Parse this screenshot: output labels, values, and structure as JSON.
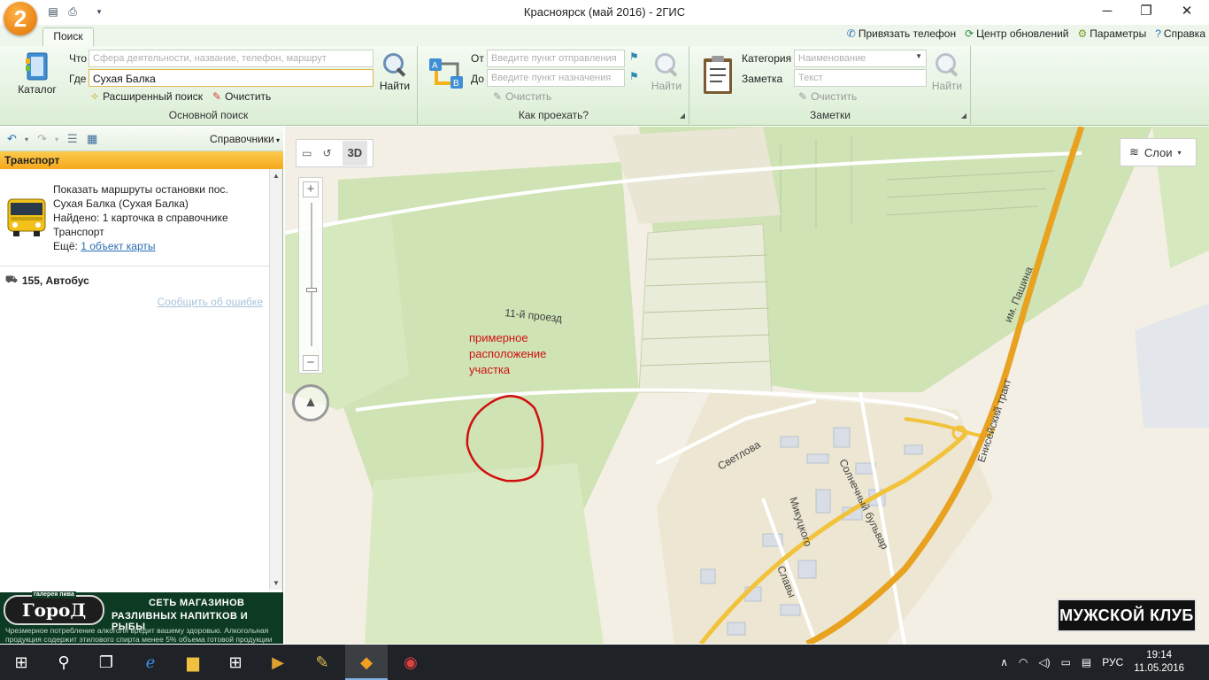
{
  "window": {
    "title": "Красноярск (май 2016) - 2ГИС",
    "logo": "2",
    "minimize": "─",
    "maximize": "❐",
    "close": "✕"
  },
  "ribbon": {
    "active_tab": "Поиск",
    "top_links": [
      {
        "icon": "phone-icon",
        "label": "Привязать телефон"
      },
      {
        "icon": "refresh-icon",
        "label": "Центр обновлений"
      },
      {
        "icon": "gear-icon",
        "label": "Параметры"
      },
      {
        "icon": "help-icon",
        "label": "Справка"
      }
    ],
    "main_search": {
      "title": "Основной поиск",
      "catalog_label": "Каталог",
      "what_label": "Что",
      "what_placeholder": "Сфера деятельности, название, телефон, маршрут",
      "where_label": "Где",
      "where_value": "Сухая Балка",
      "find_label": "Найти",
      "advanced_label": "Расширенный поиск",
      "clear_label": "Очистить"
    },
    "route": {
      "title": "Как проехать?",
      "from_label": "От",
      "from_placeholder": "Введите пункт отправления",
      "to_label": "До",
      "to_placeholder": "Введите пункт назначения",
      "find_label": "Найти",
      "clear_label": "Очистить"
    },
    "notes": {
      "title": "Заметки",
      "category_label": "Категория",
      "category_placeholder": "Наименование",
      "note_label": "Заметка",
      "note_placeholder": "Текст",
      "find_label": "Найти",
      "clear_label": "Очистить"
    }
  },
  "left_panel": {
    "directory_label": "Справочники",
    "section": "Транспорт",
    "result": {
      "line1": "Показать маршруты остановки пос.",
      "line2": "Сухая Балка (Сухая Балка)",
      "line3": "Найдено: 1 карточка в справочнике",
      "line4": "Транспорт",
      "more_label": "Ещё:",
      "more_link": "1 объект карты"
    },
    "route_item": "155, Автобус",
    "report_link": "Сообщить об ошибке",
    "ad": {
      "logo": "ГороД",
      "logo_small": "галерея пива",
      "line1": "СЕТЬ МАГАЗИНОВ",
      "line2": "РАЗЛИВНЫХ НАПИТКОВ И РЫБЫ",
      "warning": "Чрезмерное потребление алкоголя вредит вашему здоровью. Алкогольная продукция содержит этилового спирта менее 5% объема готовой продукции"
    }
  },
  "map": {
    "btn_3d": "3D",
    "layers_label": "Слои",
    "annotation": "примерное\nрасположение\nучастка",
    "streets": {
      "proezd": "11-й проезд",
      "pashina": "им. Пашина",
      "enisey": "Енисейский тракт",
      "svetlova": "Светлова",
      "solnechny": "Солнечный бульвар",
      "mikuckogo": "Микуцкого",
      "slavy": "Славы"
    },
    "ad_club": "МУЖСКОЙ КЛУБ"
  },
  "taskbar": {
    "lang": "РУС",
    "time": "19:14",
    "date": "11.05.2016"
  }
}
